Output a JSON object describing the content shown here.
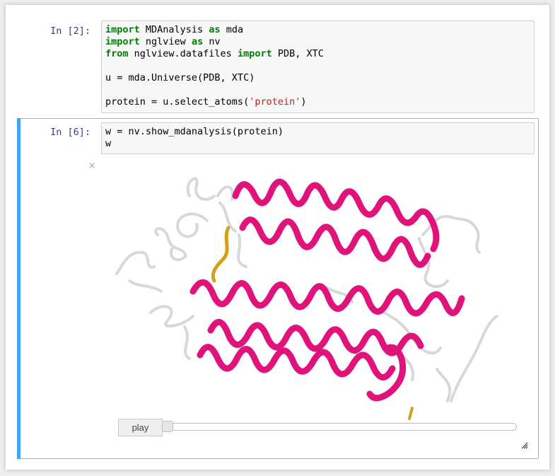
{
  "cells": [
    {
      "prompt": "In [2]:",
      "lines": [
        [
          {
            "t": "import",
            "c": "kw"
          },
          {
            "t": " MDAnalysis ",
            "c": ""
          },
          {
            "t": "as",
            "c": "kw"
          },
          {
            "t": " mda",
            "c": ""
          }
        ],
        [
          {
            "t": "import",
            "c": "kw"
          },
          {
            "t": " nglview ",
            "c": ""
          },
          {
            "t": "as",
            "c": "kw"
          },
          {
            "t": " nv",
            "c": ""
          }
        ],
        [
          {
            "t": "from",
            "c": "kw"
          },
          {
            "t": " nglview.datafiles ",
            "c": ""
          },
          {
            "t": "import",
            "c": "kw"
          },
          {
            "t": " PDB, XTC",
            "c": ""
          }
        ],
        [],
        [
          {
            "t": "u = mda.Universe(PDB, XTC)",
            "c": ""
          }
        ],
        [],
        [
          {
            "t": "protein = u.select_atoms(",
            "c": ""
          },
          {
            "t": "'protein'",
            "c": "str"
          },
          {
            "t": ")",
            "c": ""
          }
        ]
      ]
    },
    {
      "prompt": "In [6]:",
      "lines": [
        [
          {
            "t": "w = nv.show_mdanalysis(protein)",
            "c": ""
          }
        ],
        [
          {
            "t": "w",
            "c": ""
          }
        ]
      ]
    }
  ],
  "widget": {
    "close_symbol": "×",
    "play_label": "play",
    "slider_value": 0,
    "colors": {
      "helix": "#e0137a",
      "coil": "#dcdcdc",
      "strand": "#d4a017"
    }
  },
  "colors": {
    "prompt": "#303f9f",
    "keyword": "#008000",
    "string": "#ba2121",
    "selected_bar": "#42a5f5"
  }
}
